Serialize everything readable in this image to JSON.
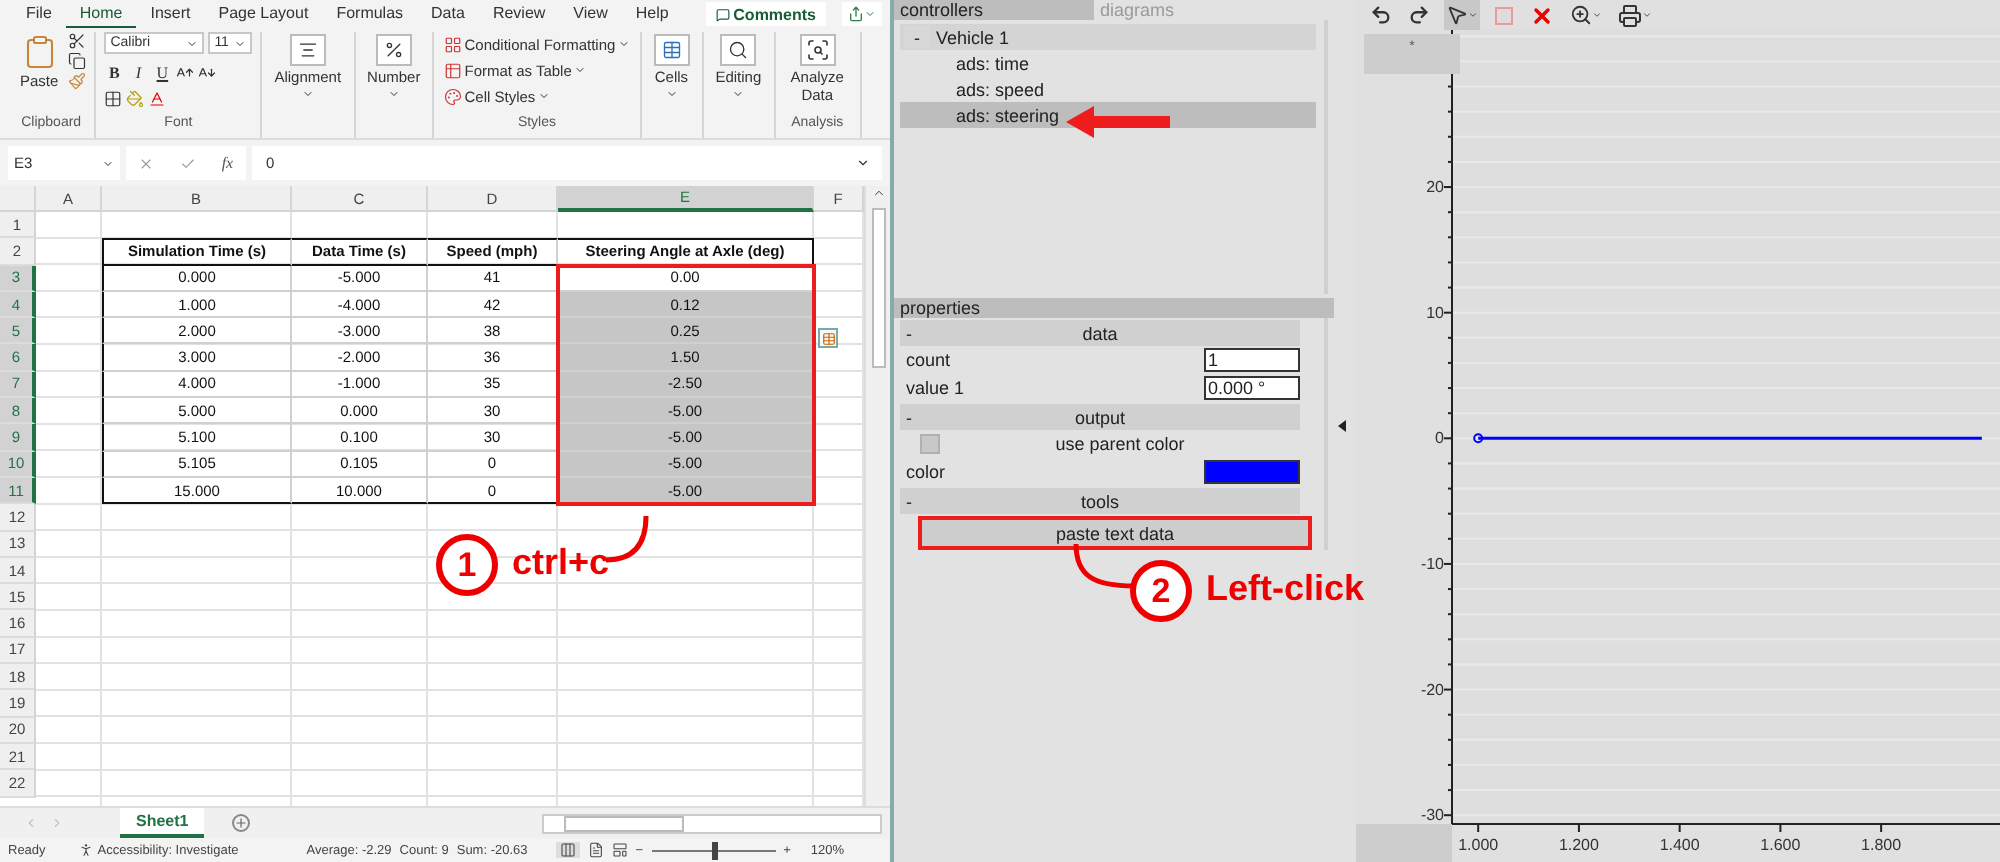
{
  "excel": {
    "ribbon_tabs": [
      {
        "label": "File",
        "selected": false
      },
      {
        "label": "Home",
        "selected": true
      },
      {
        "label": "Insert",
        "selected": false
      },
      {
        "label": "Page Layout",
        "selected": false
      },
      {
        "label": "Formulas",
        "selected": false
      },
      {
        "label": "Data",
        "selected": false
      },
      {
        "label": "Review",
        "selected": false
      },
      {
        "label": "View",
        "selected": false
      },
      {
        "label": "Help",
        "selected": false
      }
    ],
    "comments_button": "Comments",
    "clipboard": {
      "paste": "Paste",
      "caption": "Clipboard"
    },
    "font": {
      "name": "Calibri",
      "size": "11",
      "format_buttons": [
        "B",
        "I",
        "U"
      ],
      "caption": "Font"
    },
    "alignment": "Alignment",
    "number": "Number",
    "styles": {
      "items": [
        "Conditional Formatting",
        "Format as Table",
        "Cell Styles"
      ],
      "caption": "Styles"
    },
    "cells": "Cells",
    "editing": "Editing",
    "analysis": {
      "button": "Analyze Data",
      "caption": "Analysis"
    },
    "formula_bar": {
      "name_box": "E3",
      "fx": "fx",
      "value": "0"
    },
    "columns": [
      {
        "label": "A",
        "selected": false
      },
      {
        "label": "B",
        "selected": false
      },
      {
        "label": "C",
        "selected": false
      },
      {
        "label": "D",
        "selected": false
      },
      {
        "label": "E",
        "selected": true
      },
      {
        "label": "F",
        "selected": false
      }
    ],
    "row_numbers": [
      {
        "label": "1",
        "selected": false
      },
      {
        "label": "2",
        "selected": false
      },
      {
        "label": "3",
        "selected": true
      },
      {
        "label": "4",
        "selected": true
      },
      {
        "label": "5",
        "selected": true
      },
      {
        "label": "6",
        "selected": true
      },
      {
        "label": "7",
        "selected": true
      },
      {
        "label": "8",
        "selected": true
      },
      {
        "label": "9",
        "selected": true
      },
      {
        "label": "10",
        "selected": true
      },
      {
        "label": "11",
        "selected": true
      },
      {
        "label": "12",
        "selected": false
      },
      {
        "label": "13",
        "selected": false
      },
      {
        "label": "14",
        "selected": false
      },
      {
        "label": "15",
        "selected": false
      },
      {
        "label": "16",
        "selected": false
      },
      {
        "label": "17",
        "selected": false
      },
      {
        "label": "18",
        "selected": false
      },
      {
        "label": "19",
        "selected": false
      },
      {
        "label": "20",
        "selected": false
      },
      {
        "label": "21",
        "selected": false
      },
      {
        "label": "22",
        "selected": false
      }
    ],
    "table": {
      "header": [
        "Simulation Time (s)",
        "Data Time (s)",
        "Speed (mph)",
        "Steering Angle at Axle (deg)"
      ],
      "rows": [
        {
          "cells": [
            "0.000",
            "-5.000",
            "41",
            "0.00"
          ],
          "selected": false
        },
        {
          "cells": [
            "1.000",
            "-4.000",
            "42",
            "0.12"
          ],
          "selected": true
        },
        {
          "cells": [
            "2.000",
            "-3.000",
            "38",
            "0.25"
          ],
          "selected": true
        },
        {
          "cells": [
            "3.000",
            "-2.000",
            "36",
            "1.50"
          ],
          "selected": true
        },
        {
          "cells": [
            "4.000",
            "-1.000",
            "35",
            "-2.50"
          ],
          "selected": true
        },
        {
          "cells": [
            "5.000",
            "0.000",
            "30",
            "-5.00"
          ],
          "selected": true
        },
        {
          "cells": [
            "5.100",
            "0.100",
            "30",
            "-5.00"
          ],
          "selected": true
        },
        {
          "cells": [
            "5.105",
            "0.105",
            "0",
            "-5.00"
          ],
          "selected": true
        },
        {
          "cells": [
            "15.000",
            "10.000",
            "0",
            "-5.00"
          ],
          "selected": true
        }
      ]
    },
    "sheet_tabs": [
      {
        "label": "Sheet1",
        "selected": true
      }
    ],
    "status_bar": {
      "mode": "Ready",
      "accessibility": "Accessibility: Investigate",
      "average": "Average: -2.29",
      "count": "Count: 9",
      "sum": "Sum: -20.63",
      "zoom": {
        "minus": "−",
        "level": 0.5,
        "plus": "+",
        "reading": "120%"
      }
    }
  },
  "annotations": [
    {
      "number": "1",
      "label": "ctrl+c"
    },
    {
      "number": "2",
      "label": "Left-click"
    }
  ],
  "controllers_panel": {
    "tabs": [
      {
        "label": "controllers",
        "selected": true
      },
      {
        "label": "diagrams",
        "selected": false
      }
    ],
    "tree": [
      {
        "label": "Vehicle 1",
        "toggle": "-",
        "selected": false,
        "children": [
          {
            "label": "ads: time",
            "selected": false
          },
          {
            "label": "ads: speed",
            "selected": false
          },
          {
            "label": "ads: steering",
            "selected": true
          }
        ]
      }
    ]
  },
  "properties": {
    "title": "properties",
    "sections": [
      {
        "toggle": "-",
        "title": "data",
        "rows": [
          {
            "kind": "field",
            "label": "count",
            "value": "1"
          },
          {
            "kind": "field",
            "label": "value 1",
            "value": "0.000 °"
          }
        ]
      },
      {
        "toggle": "-",
        "title": "output",
        "rows": [
          {
            "kind": "checkbox",
            "label": "use parent color",
            "checked": false
          },
          {
            "kind": "color",
            "label": "color",
            "color": "#0000ff"
          }
        ]
      },
      {
        "toggle": "-",
        "title": "tools",
        "rows": [
          {
            "kind": "button",
            "label": "paste text data"
          }
        ]
      }
    ]
  },
  "diagram": {
    "corner": "*",
    "chart_data": {
      "type": "line",
      "grid": true,
      "x": [
        1.0,
        2.0
      ],
      "series": [
        {
          "color": "#0000ff",
          "values": [
            0,
            0
          ]
        }
      ],
      "xlim": [
        0.948,
        2.036
      ],
      "ylim": [
        -30.7,
        32.5
      ],
      "xticks": [
        {
          "value": 1.0,
          "label": "1.000"
        },
        {
          "value": 1.2,
          "label": "1.200"
        },
        {
          "value": 1.4,
          "label": "1.400"
        },
        {
          "value": 1.6,
          "label": "1.600"
        },
        {
          "value": 1.8,
          "label": "1.800"
        }
      ],
      "yticks": [
        20,
        10,
        0,
        -10,
        -20,
        -30
      ]
    }
  }
}
